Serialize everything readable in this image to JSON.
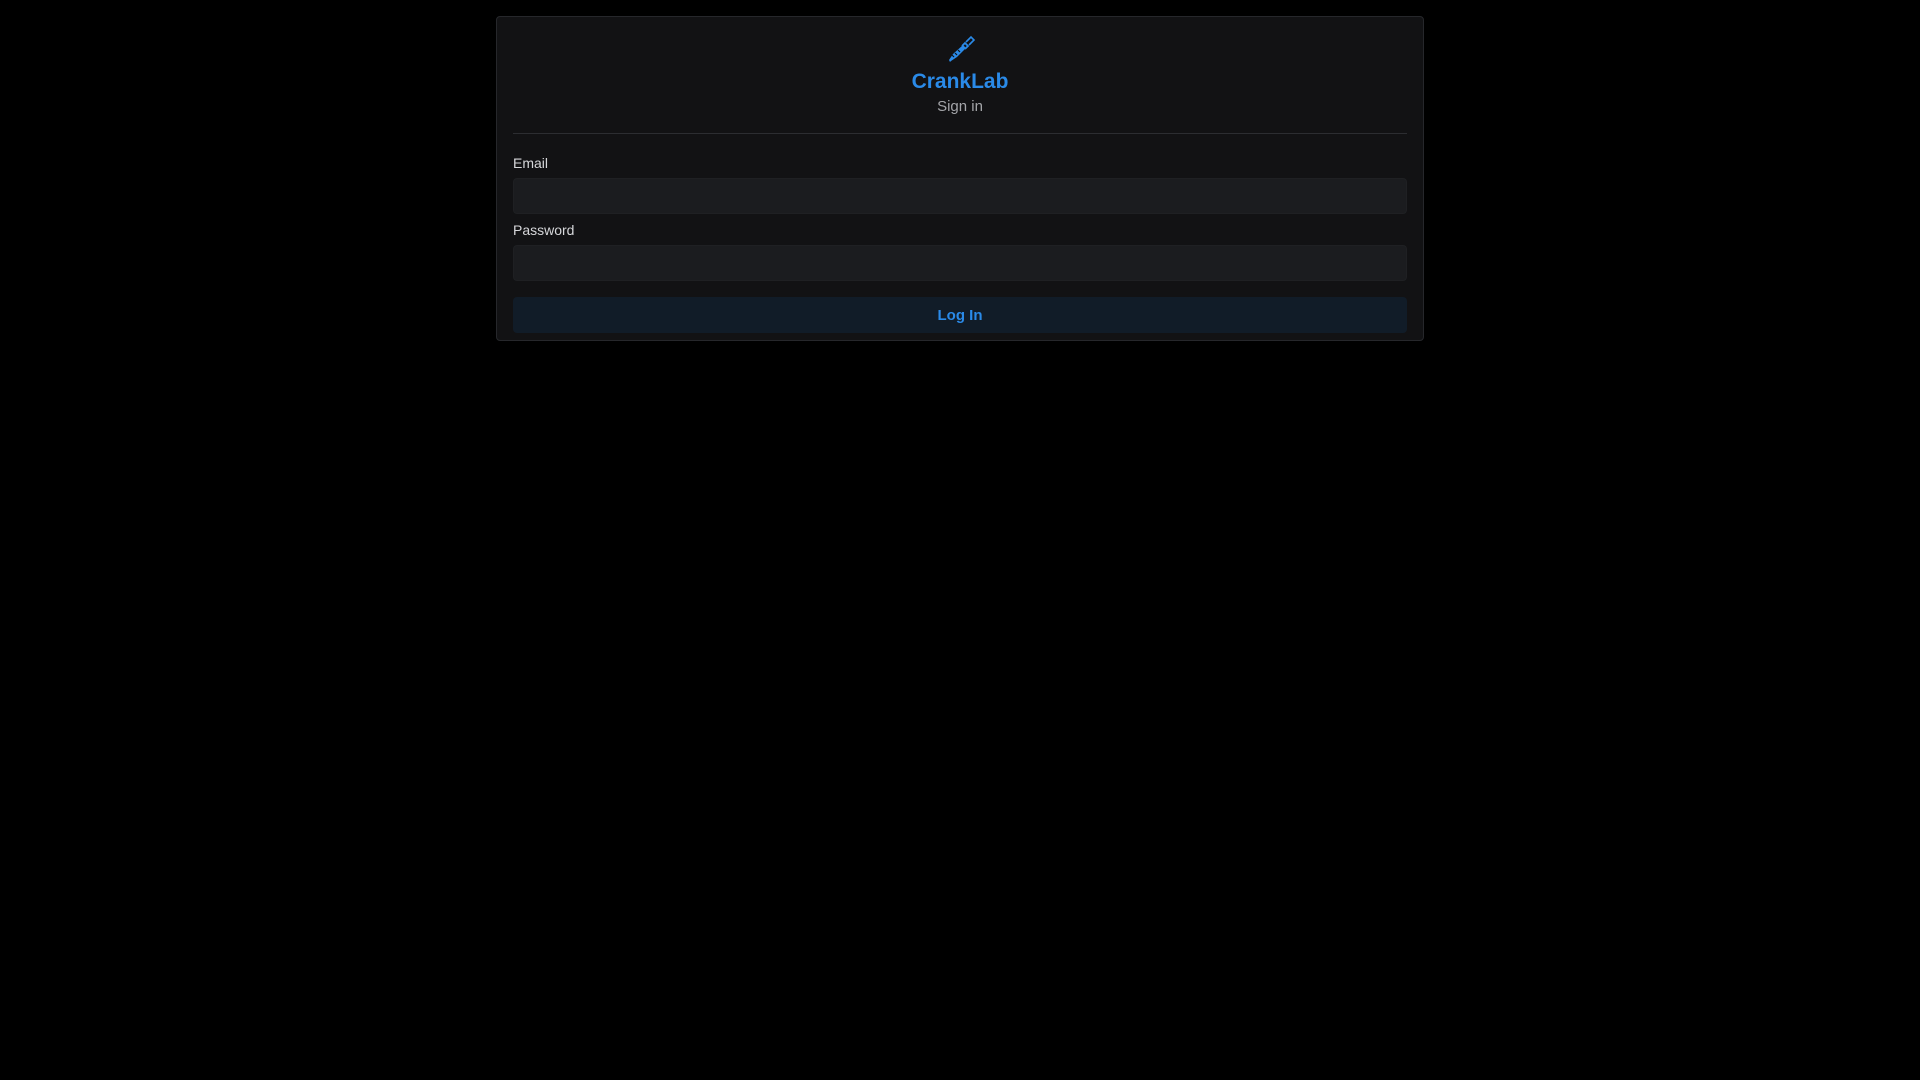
{
  "app": {
    "title": "CrankLab",
    "subtitle": "Sign in",
    "logo_icon": "pipette-icon",
    "accent_color": "#2a8ae8"
  },
  "form": {
    "email_label": "Email",
    "email_value": "",
    "password_label": "Password",
    "password_value": "",
    "submit_label": "Log In"
  }
}
